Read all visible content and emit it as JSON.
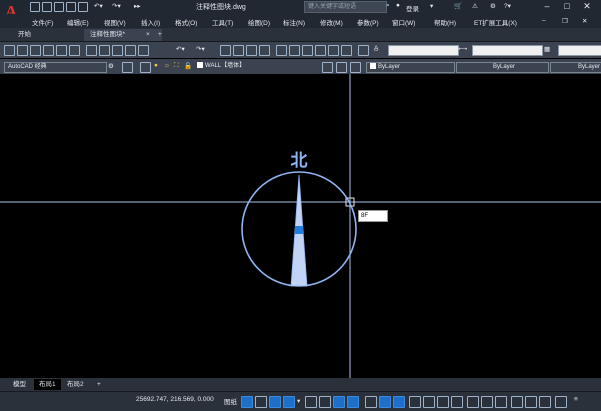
{
  "app": {
    "logo_letter": "A",
    "file_title": "注释性图块.dwg",
    "search_placeholder": "键入关键字或短语",
    "user": "登录"
  },
  "window": {
    "min": "–",
    "max": "□",
    "close": "✕"
  },
  "menu": [
    "文件(F)",
    "编辑(E)",
    "视图(V)",
    "插入(I)",
    "格式(O)",
    "工具(T)",
    "绘图(D)",
    "标注(N)",
    "修改(M)",
    "参数(P)",
    "窗口(W)",
    "帮助(H)",
    "ET扩展工具(X)"
  ],
  "tabs": {
    "start": "开始",
    "document": "注释性图块*",
    "close": "×",
    "new": "+"
  },
  "properties": {
    "workspace": "AutoCAD 经典",
    "layer": "WALL【墙体】",
    "color": "ByLayer",
    "linetype": "ByLayer",
    "lineweight": "ByLayer"
  },
  "drawing": {
    "north_label": "北",
    "dynamic_input": "8F"
  },
  "layouts": {
    "model": "模型",
    "layout1": "布局1",
    "layout2": "布局2",
    "add": "+"
  },
  "status": {
    "coords": "25692.747, 216.569, 0.000",
    "paper": "图纸"
  },
  "colors": {
    "accent": "#8fb4f0",
    "crosshair": "#a6c2e6",
    "compass": "#8fb4f0",
    "grip": "#1e7fe0",
    "logo": "#e03131"
  }
}
